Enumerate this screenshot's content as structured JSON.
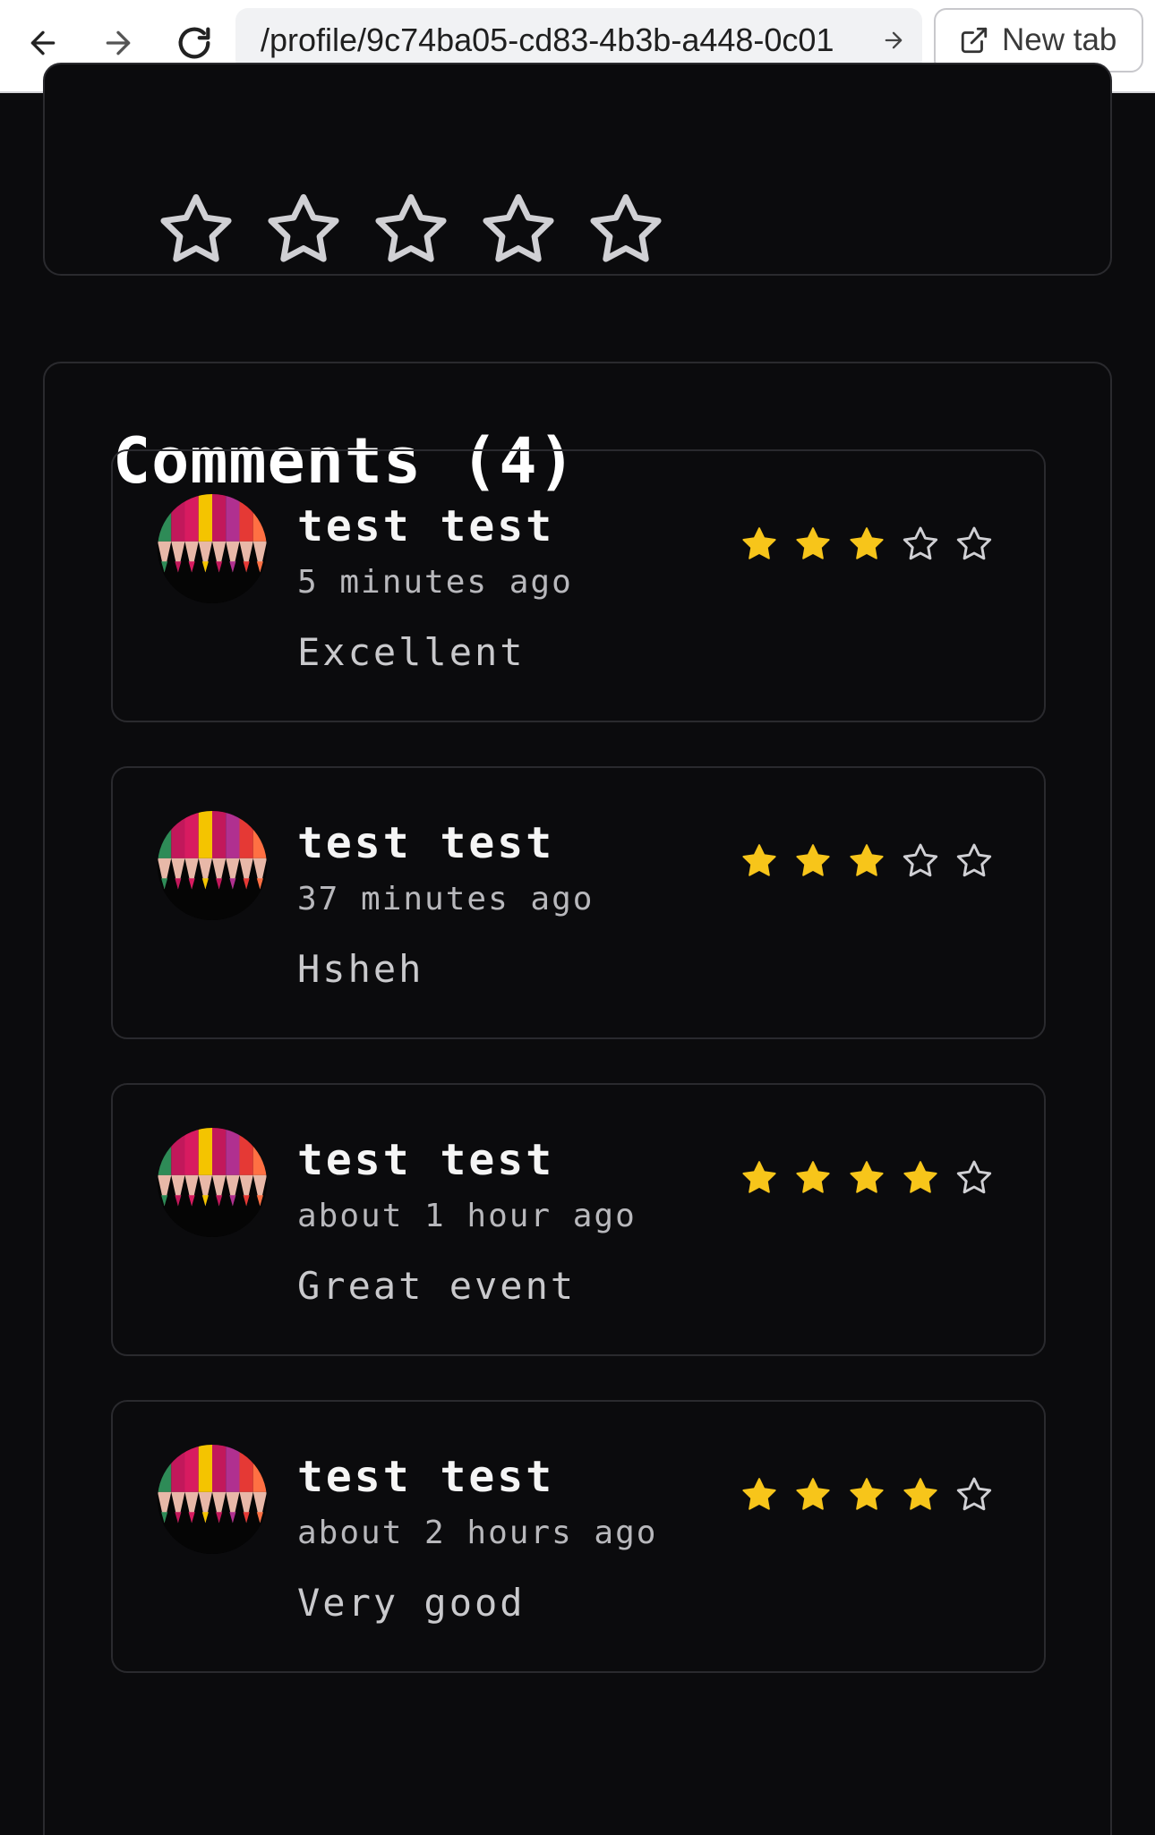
{
  "browser": {
    "url": "/profile/9c74ba05-cd83-4b3b-a448-0c01",
    "new_tab_label": "New tab"
  },
  "rating_input": {
    "max_stars": 5,
    "selected": 0
  },
  "comments": {
    "title": "Comments (4)",
    "items": [
      {
        "author": "test test",
        "time": "5 minutes ago",
        "text": "Excellent",
        "rating": 3
      },
      {
        "author": "test test",
        "time": "37 minutes ago",
        "text": "Hsheh",
        "rating": 3
      },
      {
        "author": "test test",
        "time": "about 1 hour ago",
        "text": "Great event",
        "rating": 4
      },
      {
        "author": "test test",
        "time": "about 2 hours ago",
        "text": "Very good",
        "rating": 4
      }
    ]
  },
  "colors": {
    "star_filled": "#f7c51a",
    "star_empty_stroke": "#d0d0d4",
    "background": "#0b0b0d",
    "card_border": "#2a2a2e"
  },
  "icons": {
    "back": "arrow-left-icon",
    "forward": "arrow-right-icon",
    "reload": "reload-icon",
    "go": "arrow-right-icon",
    "new_tab": "external-link-icon",
    "star": "star-icon",
    "avatar": "colored-pencils-avatar"
  }
}
